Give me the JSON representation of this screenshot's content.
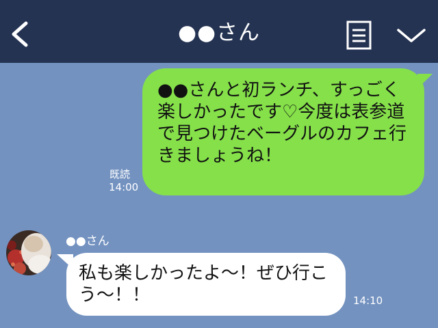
{
  "header": {
    "title": "●●さん",
    "back_icon": "chevron-left-icon",
    "menu_icon": "document-list-icon",
    "collapse_icon": "chevron-down-icon"
  },
  "messages": [
    {
      "direction": "outgoing",
      "text": "●●さんと初ランチ、すっごく楽しかったです♡今度は表参道で見つけたベーグルのカフェ行きましょうね！",
      "read_label": "既読",
      "time": "14:00"
    },
    {
      "direction": "incoming",
      "sender": "●●さん",
      "text": "私も楽しかったよ～！ぜひ行こう～！！",
      "time": "14:10"
    }
  ],
  "colors": {
    "header_bg": "#243352",
    "chat_bg": "#7392c0",
    "outgoing_bubble": "#85e04a",
    "incoming_bubble": "#ffffff"
  }
}
